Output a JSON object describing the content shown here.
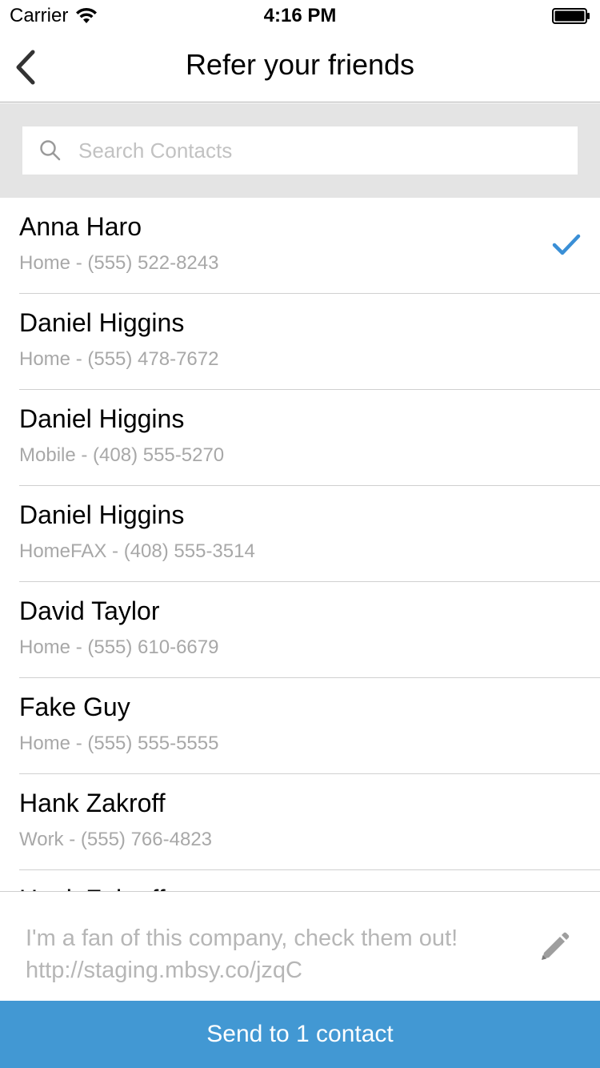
{
  "status_bar": {
    "carrier": "Carrier",
    "time": "4:16 PM"
  },
  "nav": {
    "title": "Refer your friends",
    "back_icon": "chevron-left-icon"
  },
  "search": {
    "placeholder": "Search Contacts",
    "value": "",
    "icon": "search-icon"
  },
  "contacts": [
    {
      "name": "Anna Haro",
      "phone": "Home - (555) 522-8243",
      "selected": true
    },
    {
      "name": "Daniel Higgins",
      "phone": "Home - (555) 478-7672",
      "selected": false
    },
    {
      "name": "Daniel Higgins",
      "phone": "Mobile - (408) 555-5270",
      "selected": false
    },
    {
      "name": "Daniel Higgins",
      "phone": "HomeFAX - (408) 555-3514",
      "selected": false
    },
    {
      "name": "David Taylor",
      "phone": "Home - (555) 610-6679",
      "selected": false
    },
    {
      "name": "Fake Guy",
      "phone": "Home - (555) 555-5555",
      "selected": false
    },
    {
      "name": "Hank Zakroff",
      "phone": "Work - (555) 766-4823",
      "selected": false
    },
    {
      "name": "Hank Zakroff",
      "phone": "",
      "selected": false
    }
  ],
  "message": {
    "text": "I'm a fan of this company, check them out! http://staging.mbsy.co/jzqC",
    "edit_icon": "pencil-icon"
  },
  "send_button": {
    "label": "Send to 1 contact"
  },
  "colors": {
    "accent": "#4298d3",
    "check": "#3a8fd6",
    "search_bg": "#e4e4e4",
    "secondary_text": "#a8a8a8"
  }
}
